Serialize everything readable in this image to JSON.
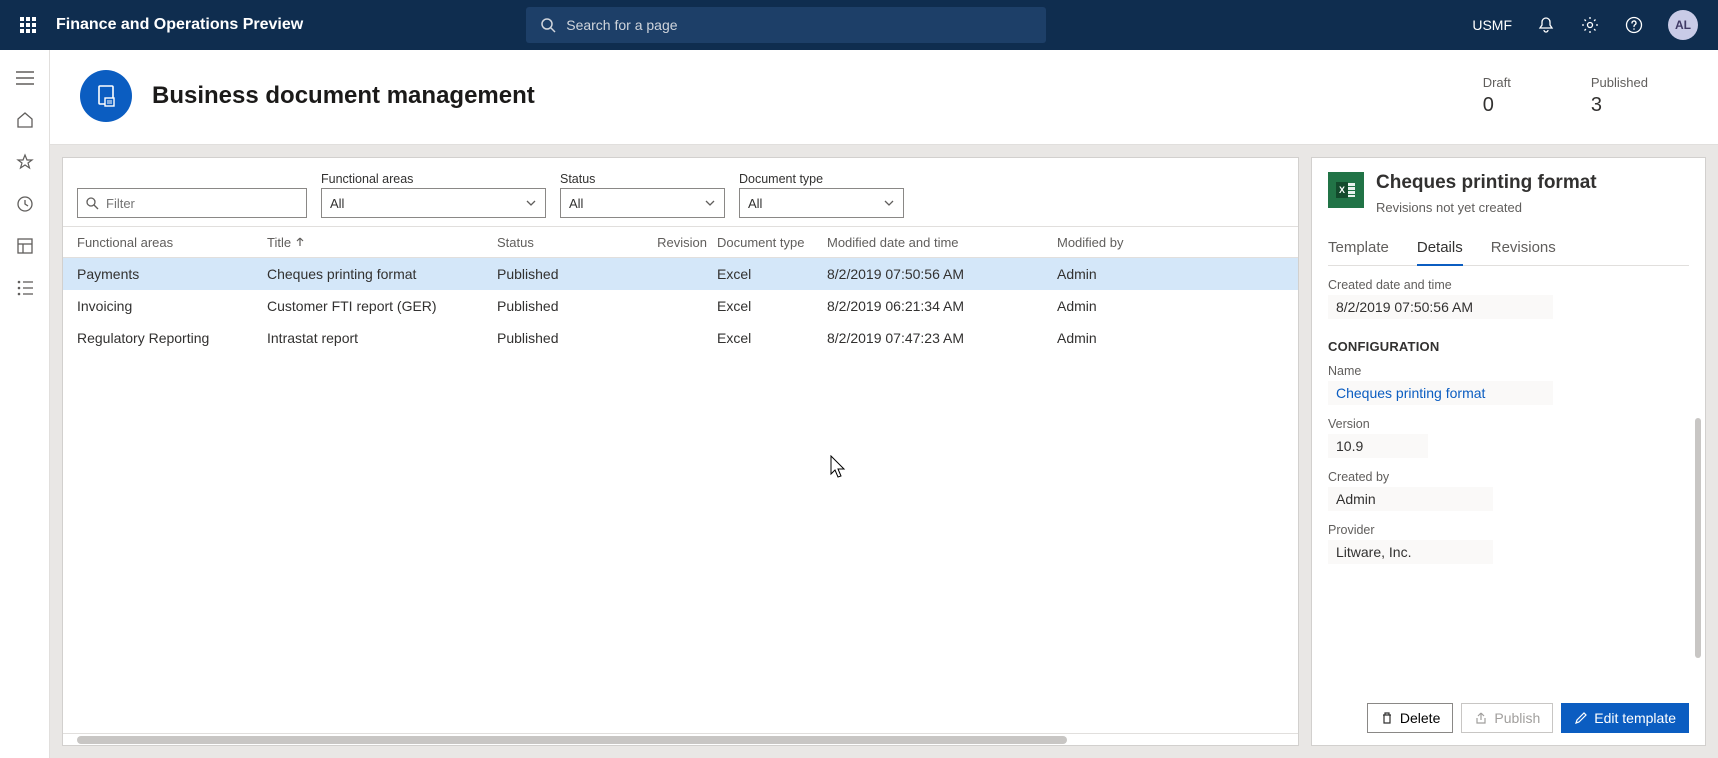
{
  "app_title": "Finance and Operations Preview",
  "search_placeholder": "Search for a page",
  "company": "USMF",
  "avatar_initials": "AL",
  "page_title": "Business document management",
  "kpis": {
    "draft_label": "Draft",
    "draft_value": "0",
    "published_label": "Published",
    "published_value": "3"
  },
  "filters": {
    "filter_placeholder": "Filter",
    "fa_label": "Functional areas",
    "fa_value": "All",
    "status_label": "Status",
    "status_value": "All",
    "doctype_label": "Document type",
    "doctype_value": "All"
  },
  "columns": {
    "fa": "Functional areas",
    "title": "Title",
    "status": "Status",
    "revision": "Revision",
    "doctype": "Document type",
    "modtime": "Modified date and time",
    "modby": "Modified by"
  },
  "rows": [
    {
      "fa": "Payments",
      "title": "Cheques printing format",
      "status": "Published",
      "revision": "",
      "doctype": "Excel",
      "modtime": "8/2/2019 07:50:56 AM",
      "modby": "Admin"
    },
    {
      "fa": "Invoicing",
      "title": "Customer FTI report (GER)",
      "status": "Published",
      "revision": "",
      "doctype": "Excel",
      "modtime": "8/2/2019 06:21:34 AM",
      "modby": "Admin"
    },
    {
      "fa": "Regulatory Reporting",
      "title": "Intrastat report",
      "status": "Published",
      "revision": "",
      "doctype": "Excel",
      "modtime": "8/2/2019 07:47:23 AM",
      "modby": "Admin"
    }
  ],
  "detail": {
    "title": "Cheques printing format",
    "subtitle": "Revisions not yet created",
    "tabs": {
      "template": "Template",
      "details": "Details",
      "revisions": "Revisions"
    },
    "created_label": "Created date and time",
    "created_value": "8/2/2019 07:50:56 AM",
    "config_header": "CONFIGURATION",
    "name_label": "Name",
    "name_value": "Cheques printing format",
    "version_label": "Version",
    "version_value": "10.9",
    "createdby_label": "Created by",
    "createdby_value": "Admin",
    "provider_label": "Provider",
    "provider_value": "Litware, Inc.",
    "actions": {
      "delete": "Delete",
      "publish": "Publish",
      "edit": "Edit template"
    }
  }
}
